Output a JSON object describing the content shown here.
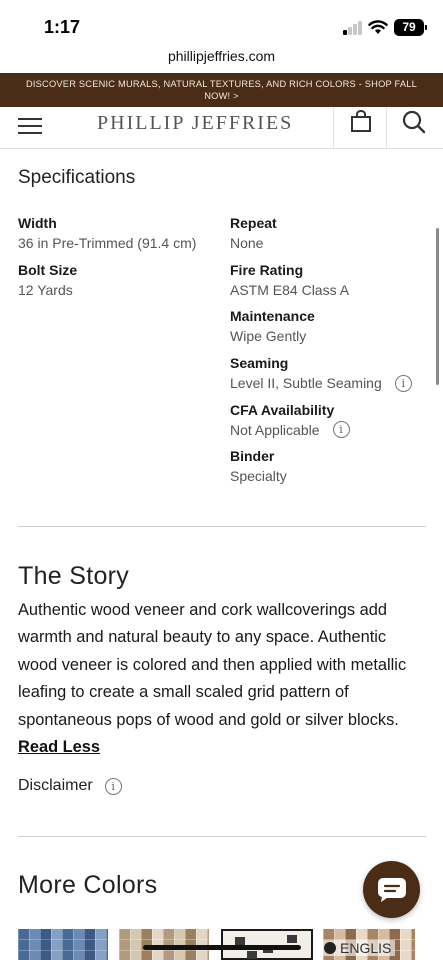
{
  "status_bar": {
    "time": "1:17",
    "battery": "79"
  },
  "browser": {
    "url": "phillipjeffries.com"
  },
  "promo": {
    "text": "DISCOVER SCENIC MURALS, NATURAL TEXTURES, AND RICH COLORS - SHOP FALL NOW! >"
  },
  "header": {
    "logo": "PHILLIP JEFFRIES"
  },
  "specifications": {
    "title": "Specifications",
    "left": [
      {
        "label": "Width",
        "value": "36 in Pre-Trimmed (91.4 cm)"
      },
      {
        "label": "Bolt Size",
        "value": "12 Yards"
      }
    ],
    "right": [
      {
        "label": "Repeat",
        "value": "None"
      },
      {
        "label": "Fire Rating",
        "value": "ASTM E84 Class A"
      },
      {
        "label": "Maintenance",
        "value": "Wipe Gently"
      },
      {
        "label": "Seaming",
        "value": "Level II, Subtle Seaming"
      },
      {
        "label": "CFA Availability",
        "value": "Not Applicable"
      },
      {
        "label": "Binder",
        "value": "Specialty"
      }
    ]
  },
  "story": {
    "title": "The Story",
    "text": "Authentic wood veneer and cork wallcoverings add warmth and natural beauty to any space. Authentic wood veneer is colored and then applied with metallic leafing to create a small scaled grid pattern of spontaneous pops of wood and gold or silver blocks. ",
    "toggle_label": "Read Less"
  },
  "disclaimer": {
    "label": "Disclaimer"
  },
  "more_colors": {
    "title": "More Colors"
  },
  "language": {
    "label": "ENGLIS"
  },
  "colors": {
    "brand": "#4a2c17"
  }
}
